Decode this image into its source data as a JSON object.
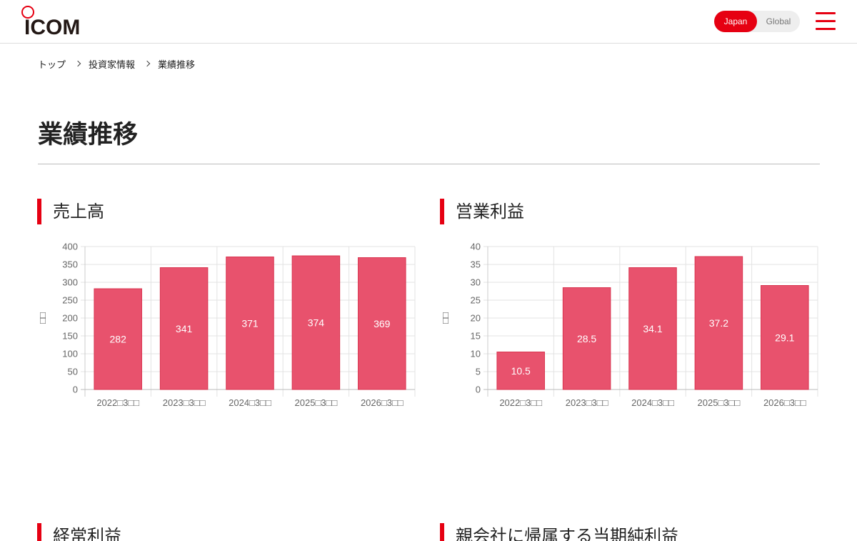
{
  "header": {
    "logo_text": "ICOM",
    "lang": {
      "japan_label": "Japan",
      "global_label": "Global",
      "active": "Japan"
    },
    "menu_icon": "hamburger-menu-icon",
    "accent_color": "#e60012"
  },
  "breadcrumb": [
    "トップ",
    "投資家情報",
    "業績推移"
  ],
  "page_title": "業績推移",
  "sections": {
    "sales_title": "売上高",
    "op_profit_title": "営業利益",
    "ordinary_profit_title": "経常利益",
    "net_profit_title": "親会社に帰属する当期純利益"
  },
  "chart_data": [
    {
      "type": "bar",
      "categories": [
        "2022年3月期",
        "2023年3月期",
        "2024年3月期",
        "2025年3月期",
        "2026年3月期"
      ],
      "category_labels_rendered": [
        "2022□3□□",
        "2023□3□□",
        "2024□3□□",
        "2025□3□□",
        "2026□3□□"
      ],
      "values": [
        282,
        341,
        371,
        374,
        369
      ],
      "ylabel": "□□",
      "ylim": [
        0,
        400
      ],
      "yticks": [
        0,
        50,
        100,
        150,
        200,
        250,
        300,
        350,
        400
      ],
      "grid": true,
      "bar_color": "#e8526d"
    },
    {
      "type": "bar",
      "categories": [
        "2022年3月期",
        "2023年3月期",
        "2024年3月期",
        "2025年3月期",
        "2026年3月期"
      ],
      "category_labels_rendered": [
        "2022□3□□",
        "2023□3□□",
        "2024□3□□",
        "2025□3□□",
        "2026□3□□"
      ],
      "values": [
        10.5,
        28.5,
        34.1,
        37.2,
        29.1
      ],
      "ylabel": "□□",
      "ylim": [
        0,
        40
      ],
      "yticks": [
        0,
        5,
        10,
        15,
        20,
        25,
        30,
        35,
        40
      ],
      "grid": true,
      "bar_color": "#e8526d"
    }
  ]
}
